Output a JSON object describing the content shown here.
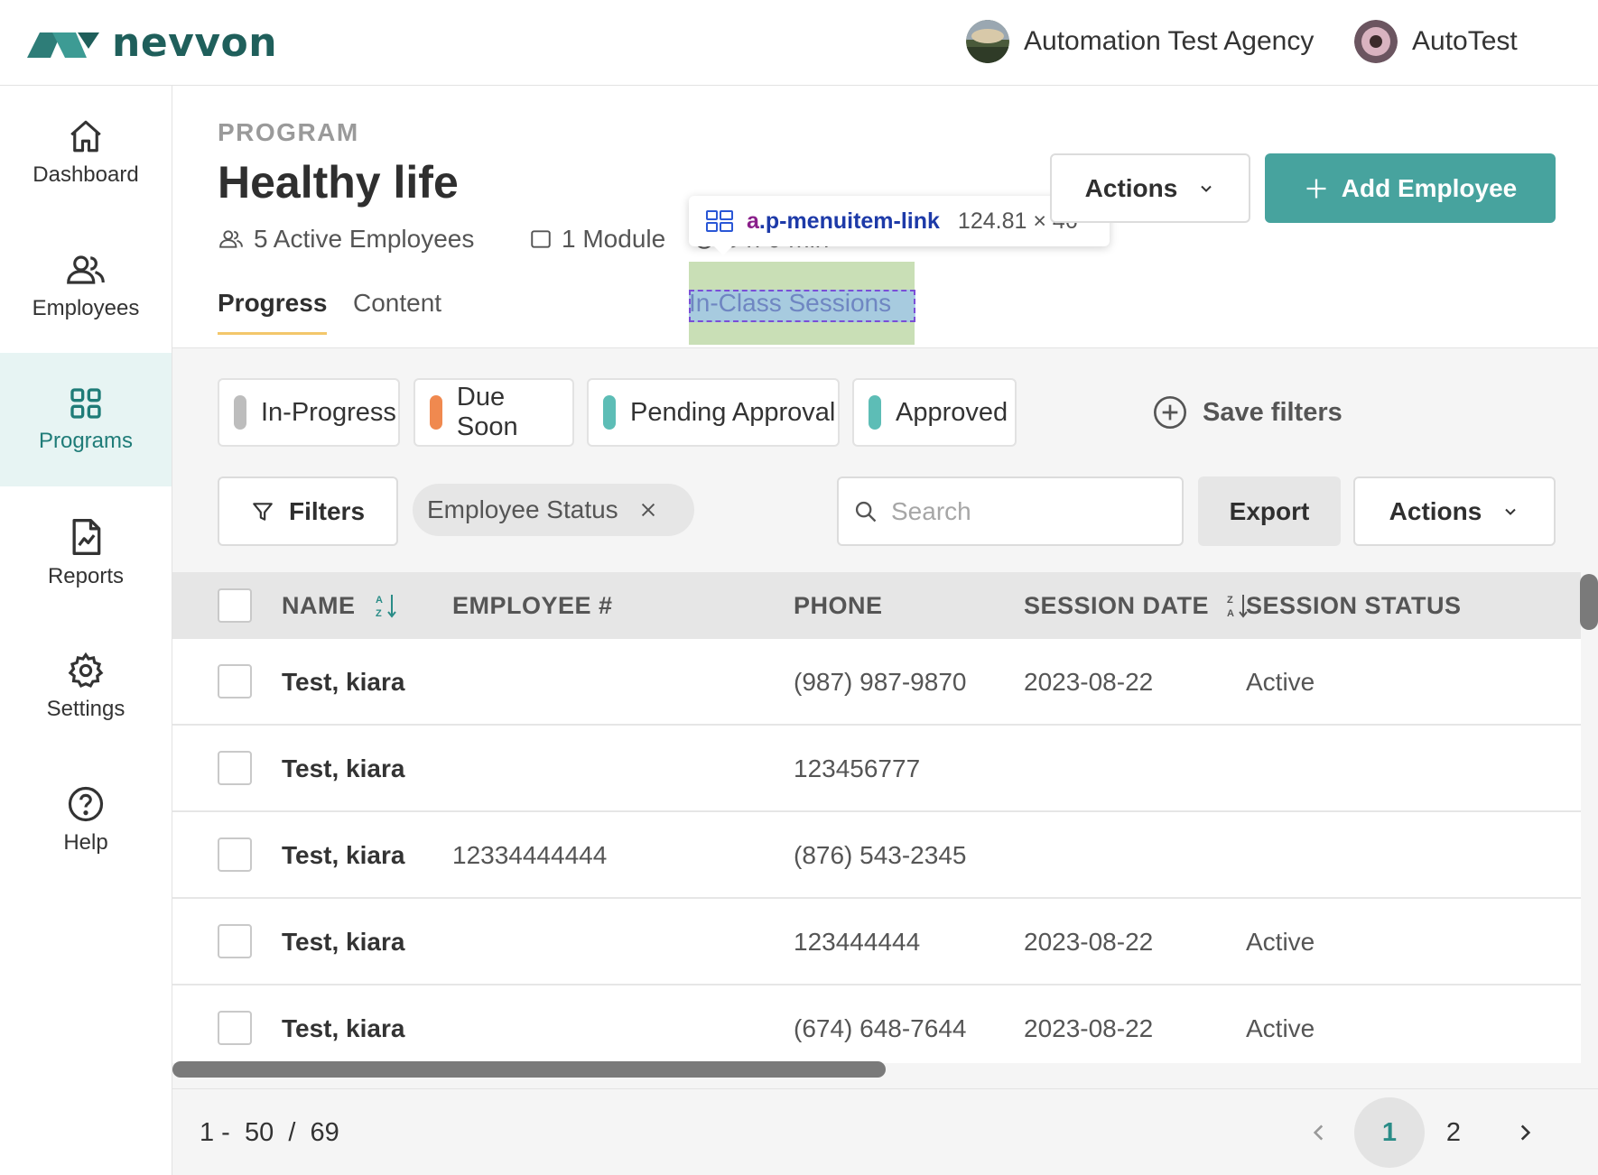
{
  "brand": {
    "name": "nevvon",
    "color": "#1f5f5b"
  },
  "topbar": {
    "agency_name": "Automation Test Agency",
    "user_name": "AutoTest"
  },
  "sidebar": {
    "items": [
      {
        "label": "Dashboard",
        "icon": "home-icon"
      },
      {
        "label": "Employees",
        "icon": "users-icon"
      },
      {
        "label": "Programs",
        "icon": "grid-icon",
        "active": true
      },
      {
        "label": "Reports",
        "icon": "report-icon"
      },
      {
        "label": "Settings",
        "icon": "gear-icon"
      },
      {
        "label": "Help",
        "icon": "help-icon"
      }
    ]
  },
  "header": {
    "eyebrow": "PROGRAM",
    "title": "Healthy life",
    "active_employees": "5 Active Employees",
    "modules_partial": "1 Module",
    "duration_partial": "0 h 0 min",
    "actions_label": "Actions",
    "add_employee_label": "Add Employee",
    "accent_color": "#47a39e"
  },
  "tabs": [
    {
      "label": "Progress",
      "active": true
    },
    {
      "label": "Content"
    },
    {
      "label": "In-Class Sessions"
    }
  ],
  "inspector_tooltip": {
    "selector_tag": "a",
    "selector_class": ".p-menuitem-link",
    "size": "124.81 × 46"
  },
  "status_filters": [
    {
      "label": "In-Progress",
      "color": "#bdbdbd"
    },
    {
      "label": "Due Soon",
      "color": "#f0894f"
    },
    {
      "label": "Pending Approval",
      "color": "#5dbdb6"
    },
    {
      "label": "Approved",
      "color": "#5dbdb6"
    }
  ],
  "save_filters_label": "Save filters",
  "toolbar": {
    "filters_label": "Filters",
    "active_filter": "Employee Status",
    "search_placeholder": "Search",
    "export_label": "Export",
    "actions_label": "Actions"
  },
  "table": {
    "columns": [
      "NAME",
      "EMPLOYEE #",
      "PHONE",
      "SESSION DATE",
      "SESSION STATUS"
    ],
    "rows": [
      {
        "name": "Test, kiara",
        "employee_no": "",
        "phone": "(987) 987-9870",
        "session_date": "2023-08-22",
        "session_status": "Active"
      },
      {
        "name": "Test, kiara",
        "employee_no": "",
        "phone": "123456777",
        "session_date": "",
        "session_status": ""
      },
      {
        "name": "Test, kiara",
        "employee_no": "12334444444",
        "phone": "(876) 543-2345",
        "session_date": "",
        "session_status": ""
      },
      {
        "name": "Test, kiara",
        "employee_no": "",
        "phone": "123444444",
        "session_date": "2023-08-22",
        "session_status": "Active"
      },
      {
        "name": "Test, kiara",
        "employee_no": "",
        "phone": "(674) 648-7644",
        "session_date": "2023-08-22",
        "session_status": "Active"
      }
    ]
  },
  "pagination": {
    "range_text": "1 -  50  /  69",
    "pages": [
      "1",
      "2"
    ],
    "current_page": "1"
  }
}
